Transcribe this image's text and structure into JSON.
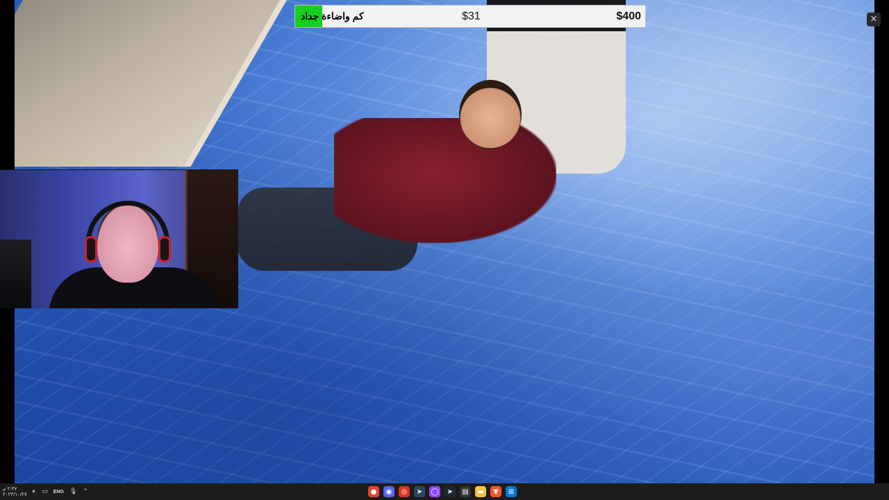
{
  "goal": {
    "title": "كم واضاءة جداد",
    "current": "$31",
    "target": "$400",
    "progress": 0.0775,
    "fill_color": "#15d01c"
  },
  "overlay": {
    "close_icon": "×"
  },
  "taskbar": {
    "clock_time": "٢:٣٧ م",
    "clock_date": "٢٠٢٣/١٠/٢٧",
    "lang": "ENG",
    "tray_icons": [
      "volume-icon",
      "network-icon",
      "microphone-icon",
      "chevron-up-icon"
    ],
    "apps": [
      {
        "name": "chrome-icon",
        "glyph": "●",
        "color": "#e94235"
      },
      {
        "name": "discord-icon",
        "glyph": "◉",
        "color": "#5865f2"
      },
      {
        "name": "obs-icon",
        "glyph": "◎",
        "color": "#d93025"
      },
      {
        "name": "steam-icon",
        "glyph": "➤",
        "color": "#2a475e"
      },
      {
        "name": "twitch-icon",
        "glyph": "◯",
        "color": "#9146ff"
      },
      {
        "name": "steam-alt-icon",
        "glyph": "➤",
        "color": "#1b2838"
      },
      {
        "name": "terminal-icon",
        "glyph": "▤",
        "color": "#333333"
      },
      {
        "name": "folder-icon",
        "glyph": "▬",
        "color": "#f4c542"
      },
      {
        "name": "brave-icon",
        "glyph": "▼",
        "color": "#fb542b"
      },
      {
        "name": "windows-icon",
        "glyph": "⊞",
        "color": "#0078d4"
      }
    ]
  }
}
